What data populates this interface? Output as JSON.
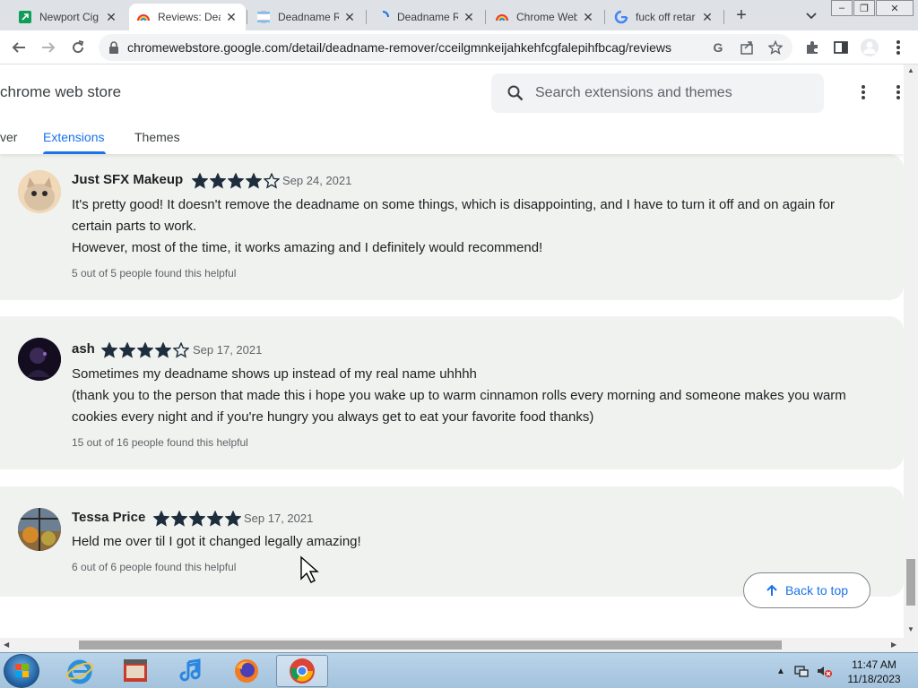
{
  "browser": {
    "tabs": [
      {
        "title": "Newport Cig",
        "favicon": "green-flag-icon"
      },
      {
        "title": "Reviews: Dea",
        "favicon": "rainbow-icon"
      },
      {
        "title": "Deadname R",
        "favicon": "trans-flag-icon"
      },
      {
        "title": "Deadname R",
        "favicon": "loading-spinner-icon"
      },
      {
        "title": "Chrome Web",
        "favicon": "rainbow-icon"
      },
      {
        "title": "fuck off retar",
        "favicon": "google-icon"
      }
    ],
    "active_tab_index": 1,
    "url": "chromewebstore.google.com/detail/deadname-remover/cceilgmnkeijahkehfcgfalepihfbcag/reviews"
  },
  "store": {
    "brand": "chrome web store",
    "search_placeholder": "Search extensions and themes",
    "nav": {
      "partial": "ver",
      "extensions": "Extensions",
      "themes": "Themes"
    },
    "back_to_top": "Back to top"
  },
  "reviews": [
    {
      "name": "Just SFX Makeup",
      "rating": 4,
      "date": "Sep 24, 2021",
      "lines": [
        "It's pretty good! It doesn't remove the deadname on some things, which is disappointing, and I have to turn it off and on again for certain parts to work.",
        "However, most of the time, it works amazing and I definitely would recommend!"
      ],
      "helpful": "5 out of 5 people found this helpful"
    },
    {
      "name": "ash",
      "rating": 4,
      "date": "Sep 17, 2021",
      "lines": [
        "Sometimes my deadname shows up instead of my real name uhhhh",
        "(thank you to the person that made this i hope you wake up to warm cinnamon rolls every morning and someone makes you warm cookies every night and if you're hungry you always get to eat your favorite food thanks)"
      ],
      "helpful": "15 out of 16 people found this helpful"
    },
    {
      "name": "Tessa Price",
      "rating": 5,
      "date": "Sep 17, 2021",
      "lines": [
        "Held me over til I got it changed legally amazing!"
      ],
      "helpful": "6 out of 6 people found this helpful"
    }
  ],
  "taskbar": {
    "apps": [
      "internet-explorer-icon",
      "media-center-icon",
      "itunes-icon",
      "firefox-icon",
      "chrome-icon"
    ],
    "time": "11:47 AM",
    "date": "11/18/2023"
  },
  "colors": {
    "accent": "#1a73e8",
    "star": "#1e2d3d",
    "review_bg": "#f0f2ef"
  }
}
